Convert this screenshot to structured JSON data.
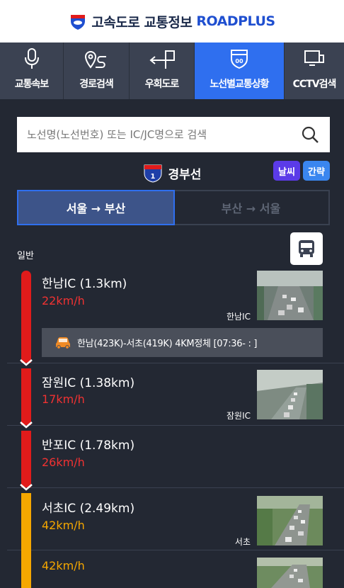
{
  "header": {
    "title": "고속도로 교통정보",
    "brand": "ROADPLUS",
    "logo_icon": "highway-shield-icon"
  },
  "tabs": [
    {
      "label": "교통속보",
      "icon": "microphone-icon",
      "active": false
    },
    {
      "label": "경로검색",
      "icon": "route-pin-icon",
      "active": false
    },
    {
      "label": "우회도로",
      "icon": "detour-arrow-icon",
      "active": false
    },
    {
      "label": "노선별교통상황",
      "icon": "route-shield-icon",
      "active": true
    },
    {
      "label": "CCTV검색",
      "icon": "cctv-monitor-icon",
      "active": false
    }
  ],
  "search": {
    "placeholder": "노선명(노선번호) 또는 IC/JC명으로 검색",
    "value": ""
  },
  "route": {
    "number": "1",
    "name": "경부선",
    "weather_label": "날씨",
    "simple_label": "간략"
  },
  "directions": {
    "active": "서울 → 부산",
    "inactive": "부산 → 서울"
  },
  "section": {
    "label": "일반"
  },
  "segments": [
    {
      "name": "한남IC (1.3km)",
      "speed": "22km/h",
      "status": "congested",
      "cam_label": "한남IC"
    },
    {
      "name": "잠원IC (1.38km)",
      "speed": "17km/h",
      "status": "congested",
      "cam_label": "잠원IC"
    },
    {
      "name": "반포IC (1.78km)",
      "speed": "26km/h",
      "status": "congested",
      "cam_label": ""
    },
    {
      "name": "서초IC (2.49km)",
      "speed": "42km/h",
      "status": "slow",
      "cam_label": "서초"
    },
    {
      "name": "",
      "speed": "42km/h",
      "status": "slow",
      "cam_label": ""
    }
  ],
  "alert": {
    "text": "한남(423K)-서초(419K) 4KM정체 [07:36- : ]",
    "icon": "car-icon"
  },
  "colors": {
    "background": "#232833",
    "tab_bar": "#3b4252",
    "tab_active": "#2f6fef",
    "congested": "#e11b1b",
    "slow": "#f5a700",
    "brand": "#1f4fd0"
  }
}
